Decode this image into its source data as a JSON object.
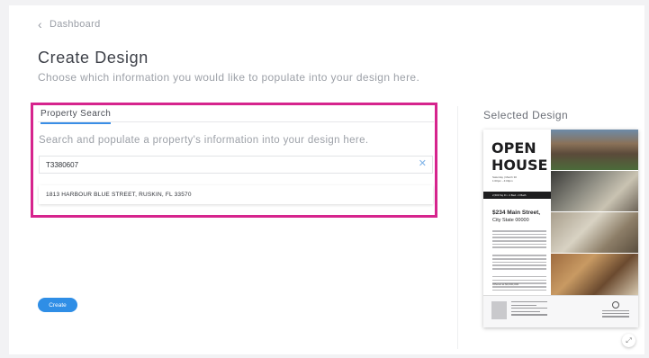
{
  "nav": {
    "back_label": "Dashboard"
  },
  "page": {
    "title": "Create Design",
    "subtitle": "Choose which information you would like to populate into your design here."
  },
  "property_search": {
    "tab_label": "Property Search",
    "description": "Search and populate a property's information into your design here.",
    "input_value": "T3380607",
    "results": [
      "1813 HARBOUR BLUE STREET, RUSKIN, FL 33570"
    ]
  },
  "actions": {
    "create_label": "Create"
  },
  "selected_design": {
    "title": "Selected Design",
    "flyer": {
      "open_house": "OPEN HOUSE",
      "date_line": "Saturday | March 30",
      "time_line": "1:00pm - 4:00pm",
      "stats": "2,500 Sq Ft  •  4 Bed  •  3 Bath",
      "price": "$234 Main Street,",
      "address": "City State 00000",
      "offered_at": "Offered at   $0,000,000"
    }
  },
  "colors": {
    "accent": "#2f8ee6",
    "highlight": "#d6248d"
  }
}
